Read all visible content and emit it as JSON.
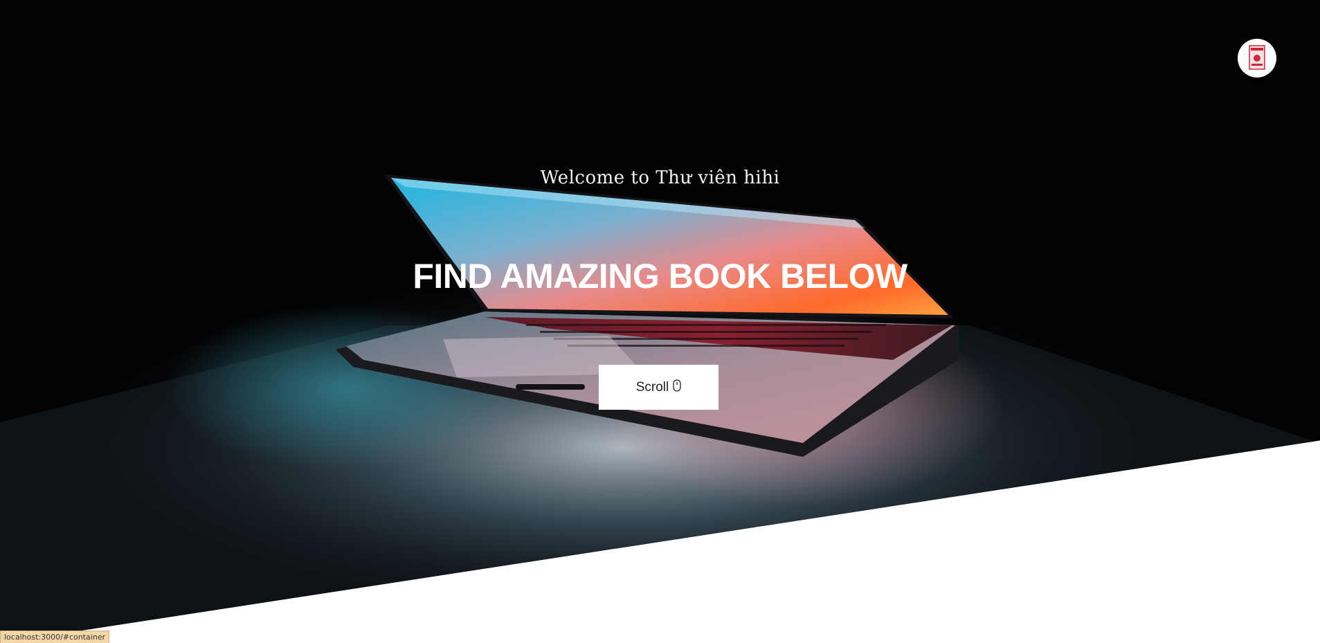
{
  "header": {
    "logo_icon": "library-logo-icon"
  },
  "hero": {
    "welcome_text": "Welcome to Thư viên hihi",
    "headline": "FIND AMAZING BOOK BELOW",
    "scroll_button": {
      "label": "Scroll",
      "icon": "mouse-icon"
    },
    "background_image": "laptop-photo"
  },
  "status_bar": {
    "url": "localhost:3000/#container"
  },
  "colors": {
    "hero_background": "#020203",
    "text": "#ffffff",
    "button_background": "#ffffff",
    "status_background": "#f4d7a8"
  }
}
